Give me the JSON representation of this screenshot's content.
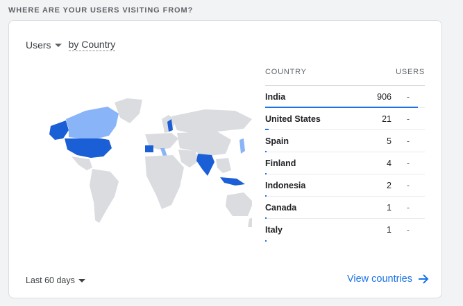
{
  "section": {
    "title": "WHERE ARE YOUR USERS VISITING FROM?"
  },
  "selector": {
    "metric": "Users",
    "dimension": "by Country"
  },
  "table": {
    "header_country": "COUNTRY",
    "header_users": "USERS",
    "rows": [
      {
        "country": "India",
        "users": "906",
        "change": "-",
        "share": 1.0
      },
      {
        "country": "United States",
        "users": "21",
        "change": "-",
        "share": 0.023
      },
      {
        "country": "Spain",
        "users": "5",
        "change": "-",
        "share": 0.006
      },
      {
        "country": "Finland",
        "users": "4",
        "change": "-",
        "share": 0.004
      },
      {
        "country": "Indonesia",
        "users": "2",
        "change": "-",
        "share": 0.002
      },
      {
        "country": "Canada",
        "users": "1",
        "change": "-",
        "share": 0.001
      },
      {
        "country": "Italy",
        "users": "1",
        "change": "-",
        "share": 0.001
      }
    ]
  },
  "footer": {
    "date_range": "Last 60 days",
    "view_link": "View countries"
  },
  "colors": {
    "accent": "#1a73e8",
    "map_dark": "#1a5fd6",
    "map_light": "#8ab4f8",
    "map_base": "#dadce0"
  }
}
